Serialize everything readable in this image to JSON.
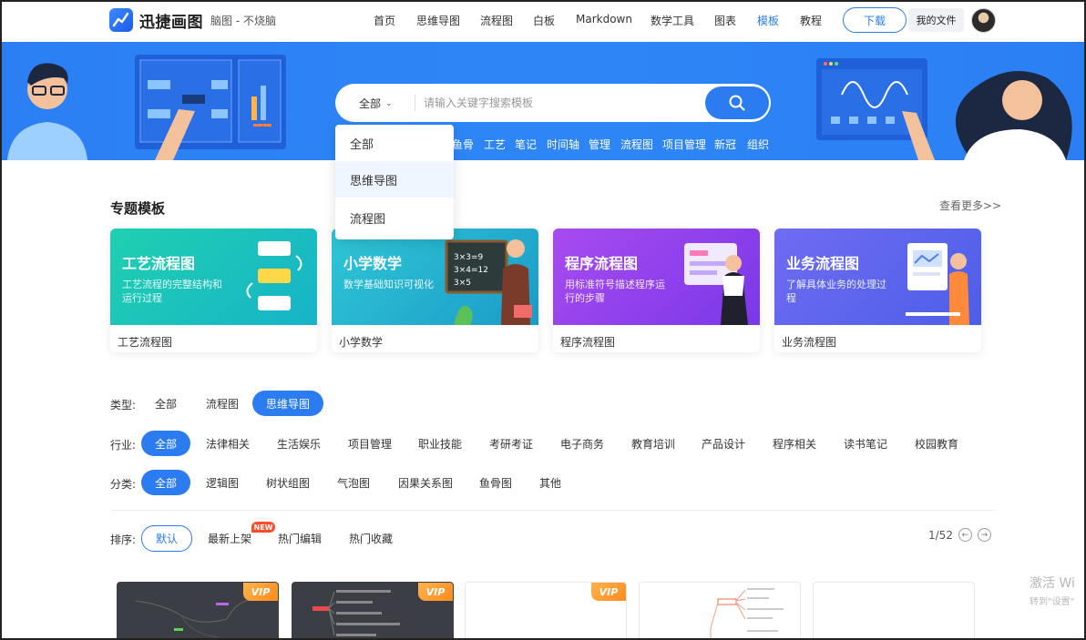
{
  "brand": {
    "name": "迅捷画图",
    "sub": "脑图 - 不烧脑"
  },
  "nav": {
    "links": [
      "首页",
      "思维导图",
      "流程图",
      "白板",
      "Markdown",
      "数学工具",
      "图表",
      "模板",
      "教程"
    ],
    "download": "下载",
    "my_files": "我的文件"
  },
  "search": {
    "scope": "全部",
    "placeholder": "请输入关键字搜索模板",
    "hot_tags": [
      "鱼骨",
      "工艺",
      "笔记",
      "时间轴",
      "管理",
      "流程图",
      "项目管理",
      "新冠",
      "组织"
    ],
    "dropdown": [
      "全部",
      "思维导图",
      "流程图"
    ]
  },
  "topics": {
    "title": "专题模板",
    "more": "查看更多>>",
    "cards": [
      {
        "title": "工艺流程图",
        "desc": "工艺流程的完整结构和运行过程",
        "caption": "工艺流程图"
      },
      {
        "title": "小学数学",
        "desc": "数学基础知识可视化",
        "caption": "小学数学"
      },
      {
        "title": "程序流程图",
        "desc": "用标准符号描述程序运行的步骤",
        "caption": "程序流程图"
      },
      {
        "title": "业务流程图",
        "desc": "了解具体业务的处理过程",
        "caption": "业务流程图"
      }
    ]
  },
  "filters": {
    "type": {
      "label": "类型:",
      "options": [
        "全部",
        "流程图",
        "思维导图"
      ]
    },
    "industry": {
      "label": "行业:",
      "options": [
        "全部",
        "法律相关",
        "生活娱乐",
        "项目管理",
        "职业技能",
        "考研考证",
        "电子商务",
        "教育培训",
        "产品设计",
        "程序相关",
        "读书笔记",
        "校园教育"
      ]
    },
    "category": {
      "label": "分类:",
      "options": [
        "全部",
        "逻辑图",
        "树状组图",
        "气泡图",
        "因果关系图",
        "鱼骨图",
        "其他"
      ]
    },
    "sort": {
      "label": "排序:",
      "options": [
        "默认",
        "最新上架",
        "热门编辑",
        "热门收藏"
      ],
      "new_badge": "NEW"
    }
  },
  "pager": {
    "text": "1/52"
  },
  "vip_label": "VIP",
  "watermark": {
    "line1": "激活 Wi",
    "line2": "转到\"设置\""
  },
  "colors": {
    "accent": "#2a7cf0",
    "banner": "#2e86f6",
    "vip": "#ff9a2e",
    "new_badge": "#ff4d2b"
  }
}
